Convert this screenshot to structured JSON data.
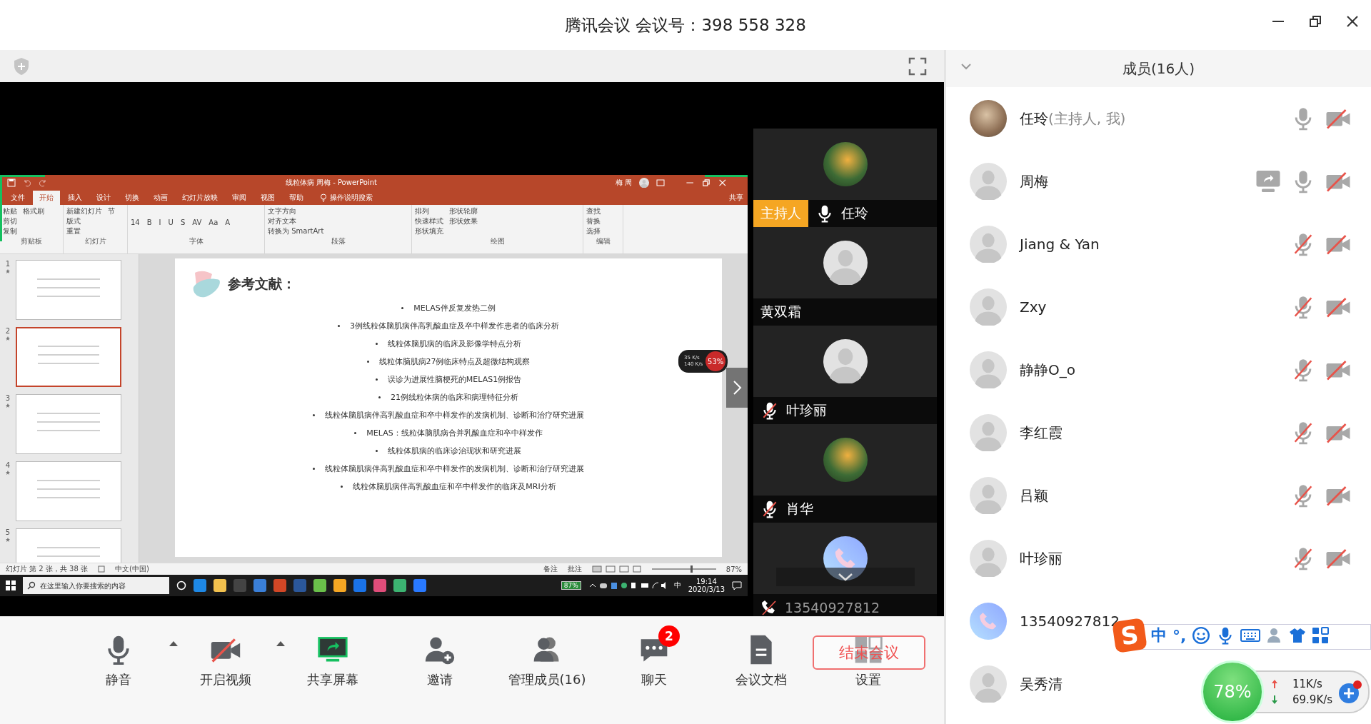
{
  "window": {
    "title": "腾讯会议 会议号：398 558 328"
  },
  "shared_screen": {
    "ppt": {
      "title": "线粒体病 周梅 - PowerPoint",
      "user": "梅 周",
      "tell_me": "操作说明搜索",
      "share": "共享",
      "tabs": [
        {
          "label": "文件",
          "selected": false
        },
        {
          "label": "开始",
          "selected": true
        },
        {
          "label": "插入",
          "selected": false
        },
        {
          "label": "设计",
          "selected": false
        },
        {
          "label": "切换",
          "selected": false
        },
        {
          "label": "动画",
          "selected": false
        },
        {
          "label": "幻灯片放映",
          "selected": false
        },
        {
          "label": "审阅",
          "selected": false
        },
        {
          "label": "视图",
          "selected": false
        },
        {
          "label": "帮助",
          "selected": false
        }
      ],
      "ribbon_groups": [
        {
          "label": "剪贴板",
          "items": [
            "粘贴",
            "剪切",
            "复制",
            "格式刷"
          ]
        },
        {
          "label": "幻灯片",
          "items": [
            "新建幻灯片",
            "版式",
            "重置",
            "节"
          ]
        },
        {
          "label": "字体",
          "items": [
            "14",
            "B",
            "I",
            "U",
            "S",
            "AV",
            "Aa",
            "A"
          ]
        },
        {
          "label": "段落",
          "items": [
            "文字方向",
            "对齐文本",
            "转换为 SmartArt"
          ]
        },
        {
          "label": "绘图",
          "items": [
            "排列",
            "快速样式",
            "形状填充",
            "形状轮廓",
            "形状效果"
          ]
        },
        {
          "label": "编辑",
          "items": [
            "查找",
            "替换",
            "选择"
          ]
        }
      ],
      "thumbnails": [
        {
          "number": "1",
          "selected": false
        },
        {
          "number": "2",
          "selected": true
        },
        {
          "number": "3",
          "selected": false
        },
        {
          "number": "4",
          "selected": false
        },
        {
          "number": "5",
          "selected": false
        }
      ],
      "slide": {
        "title": "参考文献：",
        "references": [
          "MELAS伴反复发热二例",
          "3例线粒体脑肌病伴高乳酸血症及卒中样发作患者的临床分析",
          "线粒体脑肌病的临床及影像学特点分析",
          "线粒体脑肌病27例临床特点及超微结构观察",
          "误诊为进展性脑梗死的MELAS1例报告",
          "21例线粒体病的临床和病理特征分析",
          "线粒体脑肌病伴高乳酸血症和卒中样发作的发病机制、诊断和治疗研究进展",
          "MELAS：线粒体脑肌病合并乳酸血症和卒中样发作",
          "线粒体肌病的临床诊治现状和研究进展",
          "线粒体脑肌病伴高乳酸血症和卒中样发作的发病机制、诊断和治疗研究进展",
          "线粒体脑肌病伴高乳酸血症和卒中样发作的临床及MRI分析"
        ]
      },
      "status": {
        "slide_info": "幻灯片 第 2 张，共 38 张",
        "language": "中文(中国)",
        "notes": "备注",
        "comments": "批注",
        "zoom": "87%",
        "zoom_slider": {
          "level": 0.6
        }
      }
    },
    "taskbar": {
      "search_placeholder": "在这里输入你要搜索的内容",
      "battery": "87%",
      "ime": "中",
      "time": "19:14",
      "date": "2020/3/13"
    },
    "net_widget": {
      "up": "35 K/s",
      "down": "140 K/s",
      "percent": "53%"
    }
  },
  "video_tiles": [
    {
      "name": "任玲",
      "host_label": "主持人",
      "kind": "photo",
      "muted": false
    },
    {
      "name": "黄双霜",
      "kind": "default"
    },
    {
      "name": "叶珍丽",
      "kind": "default",
      "muted": true
    },
    {
      "name": "肖华",
      "kind": "photo",
      "muted": true
    },
    {
      "name": "13540927812",
      "kind": "phone",
      "muted": true
    }
  ],
  "toolbar": [
    {
      "label": "静音",
      "kind": "mic",
      "menu": true
    },
    {
      "label": "开启视频",
      "kind": "video_off",
      "menu": true
    },
    {
      "label": "共享屏幕",
      "kind": "share_screen",
      "menu": false
    },
    {
      "label": "邀请",
      "kind": "invite",
      "menu": false
    },
    {
      "label": "管理成员(16)",
      "kind": "members",
      "menu": false
    },
    {
      "label": "聊天",
      "kind": "chat",
      "menu": false,
      "badge": "2"
    },
    {
      "label": "会议文档",
      "kind": "document",
      "menu": false
    },
    {
      "label": "设置",
      "kind": "settings",
      "menu": false
    }
  ],
  "end_meeting": {
    "label": "结束会议"
  },
  "members": {
    "title": "成员(16人)",
    "items": [
      {
        "name": "任玲",
        "note": "(主持人, 我)",
        "kind": "photo",
        "sharing": false,
        "muted": false,
        "video_off": true
      },
      {
        "name": "周梅",
        "kind": "default",
        "sharing": true,
        "muted": false,
        "video_off": true
      },
      {
        "name": "Jiang & Yan",
        "kind": "default",
        "sharing": false,
        "muted": true,
        "video_off": true
      },
      {
        "name": "Zxy",
        "kind": "default",
        "sharing": false,
        "muted": true,
        "video_off": true
      },
      {
        "name": "静静O_o",
        "kind": "default",
        "sharing": false,
        "muted": true,
        "video_off": true
      },
      {
        "name": "李红霞",
        "kind": "default",
        "sharing": false,
        "muted": true,
        "video_off": true
      },
      {
        "name": "吕颖",
        "kind": "default",
        "sharing": false,
        "muted": true,
        "video_off": true
      },
      {
        "name": "叶珍丽",
        "kind": "default",
        "sharing": false,
        "muted": true,
        "video_off": true
      },
      {
        "name": "13540927812",
        "kind": "phone",
        "sharing": false
      },
      {
        "name": "吴秀清",
        "kind": "default",
        "sharing": false
      }
    ]
  },
  "ime_toolbar": {
    "logo": "S",
    "mode": "中",
    "punctuation": "°,"
  },
  "speed_ball": {
    "percent": "78%",
    "up": "11K/s",
    "down": "69.9K/s"
  }
}
